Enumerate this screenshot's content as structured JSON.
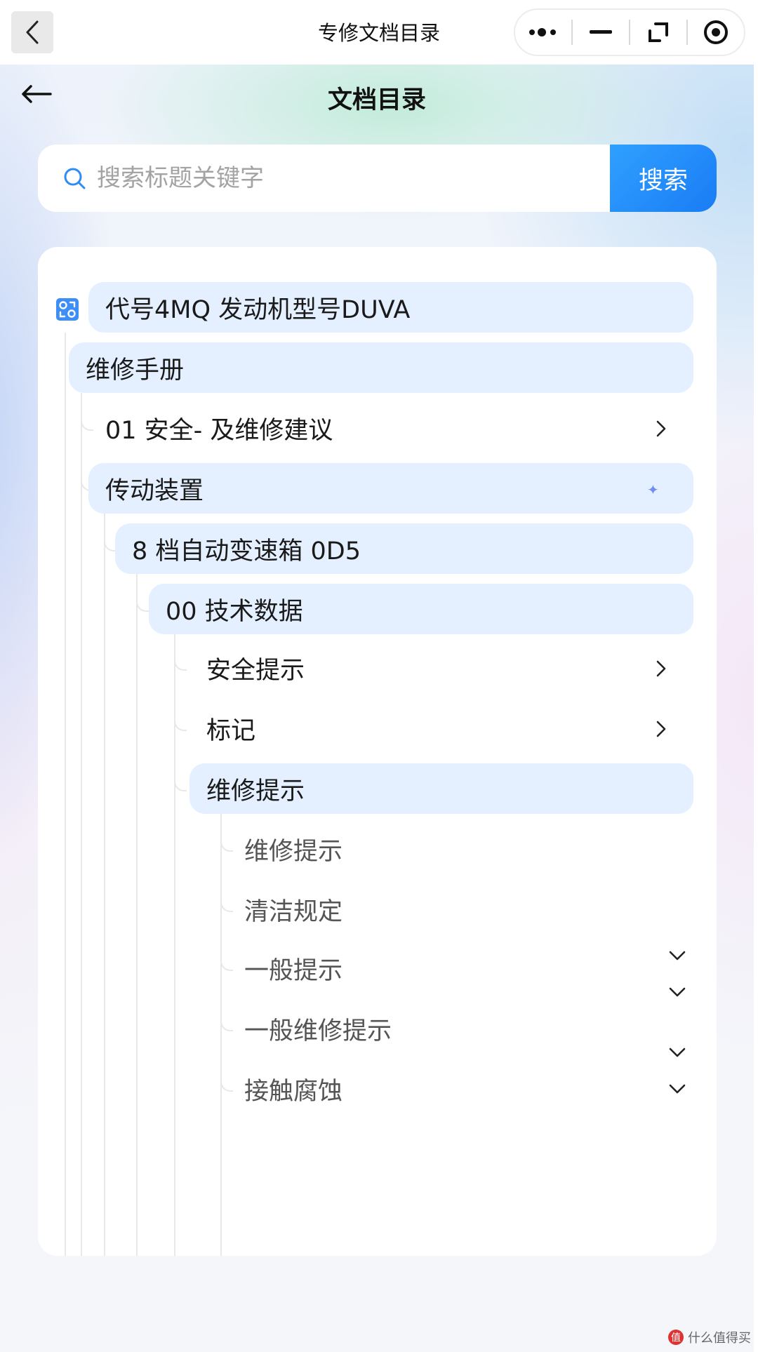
{
  "window": {
    "title": "专修文档目录",
    "capsule_icons": [
      "more-dots-icon",
      "minimize-icon",
      "restore-icon",
      "record-icon"
    ]
  },
  "header": {
    "title": "文档目录"
  },
  "search": {
    "placeholder": "搜索标题关键字",
    "button_label": "搜索"
  },
  "tree": {
    "root": "代号4MQ 发动机型号DUVA",
    "manual": "维修手册",
    "items": [
      {
        "label": "01 安全- 及维修建议",
        "expanded": false
      },
      {
        "label": "传动装置",
        "expanded": true
      },
      {
        "label": "8 档自动变速箱 0D5",
        "expanded": true
      },
      {
        "label": "00 技术数据",
        "expanded": true
      },
      {
        "label": "安全提示",
        "expanded": false
      },
      {
        "label": "标记",
        "expanded": false
      },
      {
        "label": "维修提示",
        "expanded": true
      }
    ],
    "leaves": [
      "维修提示",
      "清洁规定",
      "一般提示",
      "一般维修提示",
      "接触腐蚀"
    ]
  },
  "watermark": {
    "text": "什么值得买",
    "badge": "值"
  },
  "colors": {
    "accent": "#1a7cf5",
    "highlight": "#e4f0ff"
  }
}
